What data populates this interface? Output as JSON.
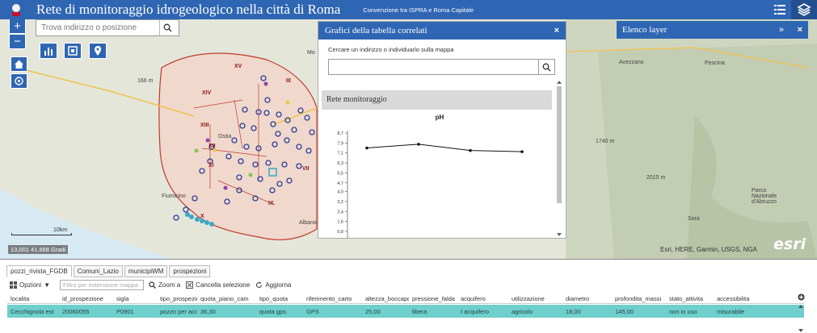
{
  "header": {
    "title": "Rete di monitoraggio idrogeologico nella città di Roma",
    "subtitle": "Convenzione tra ISPRA e Roma Capitale"
  },
  "map": {
    "search_placeholder": "Trova indirizzo o posizione",
    "zoom_in": "+",
    "zoom_out": "−",
    "scale_label": "10km",
    "coords": "13,001 41,668 Gradi",
    "attribution": "Esri, HERE, Garmin, USGS, NGA",
    "esri_logo": "esri",
    "labels": {
      "municipi": [
        "XV",
        "III",
        "XIV",
        "XIII",
        "XII",
        "XI",
        "X",
        "IX",
        "VII"
      ],
      "places": [
        "Fiumicino",
        "Albano",
        "Avezzano",
        "Pescina",
        "Sora",
        "Parco Nazionale d'Abruzzo",
        "166 m",
        "2015 m",
        "1740 m",
        "Mo",
        "Ostia"
      ]
    }
  },
  "chart_panel": {
    "title": "Grafici della tabella correlati",
    "close": "×",
    "instruction": "Cercare un indirizzo o individuarlo sulla mappa",
    "section_label": "Rete monitoraggio",
    "search_value": ""
  },
  "layer_panel": {
    "title": "Elenco layer",
    "collapse": "»",
    "close": "×"
  },
  "chart_data": {
    "type": "line",
    "title": "pH",
    "x": [
      1,
      2,
      3,
      4
    ],
    "y": [
      7.5,
      7.8,
      7.3,
      7.2
    ],
    "yticks": [
      "8,7",
      "7,9",
      "7,1",
      "6,3",
      "5,5",
      "4,7",
      "4,0",
      "3,2",
      "2,4",
      "1,6",
      "0,8"
    ],
    "ylim": [
      0.8,
      8.7
    ],
    "xlabel": "",
    "ylabel": "",
    "grid": false
  },
  "table": {
    "tabs": [
      "pozzi_rivista_FGDB",
      "Comuni_Lazio",
      "municipiWM",
      "prospezioni"
    ],
    "toolbar": {
      "options": "Opzioni",
      "filter_placeholder": "Filtro per estensione mappa",
      "zoom": "Zoom a",
      "clear": "Cancella selezione",
      "refresh": "Aggiorna"
    },
    "columns": [
      "localita",
      "id_prospezione",
      "sigla",
      "tipo_prospezione",
      "quota_piano_cam",
      "tipo_quota",
      "riferimento_carto",
      "altezza_boccapoz",
      "pressione_falda",
      "acquifero",
      "utilizzazione",
      "diametro",
      "profondita_massi",
      "stato_attivita",
      "accessibilita"
    ],
    "rows": [
      [
        "Cecchignola est",
        "20060055",
        "P0901",
        "pozzo per acqua",
        "36,30",
        "quota gps",
        "GPS",
        "25,00",
        "libera",
        "I acquifero",
        "agricolo",
        "18,00",
        "145,00",
        "non in uso",
        "misurabile"
      ]
    ]
  }
}
